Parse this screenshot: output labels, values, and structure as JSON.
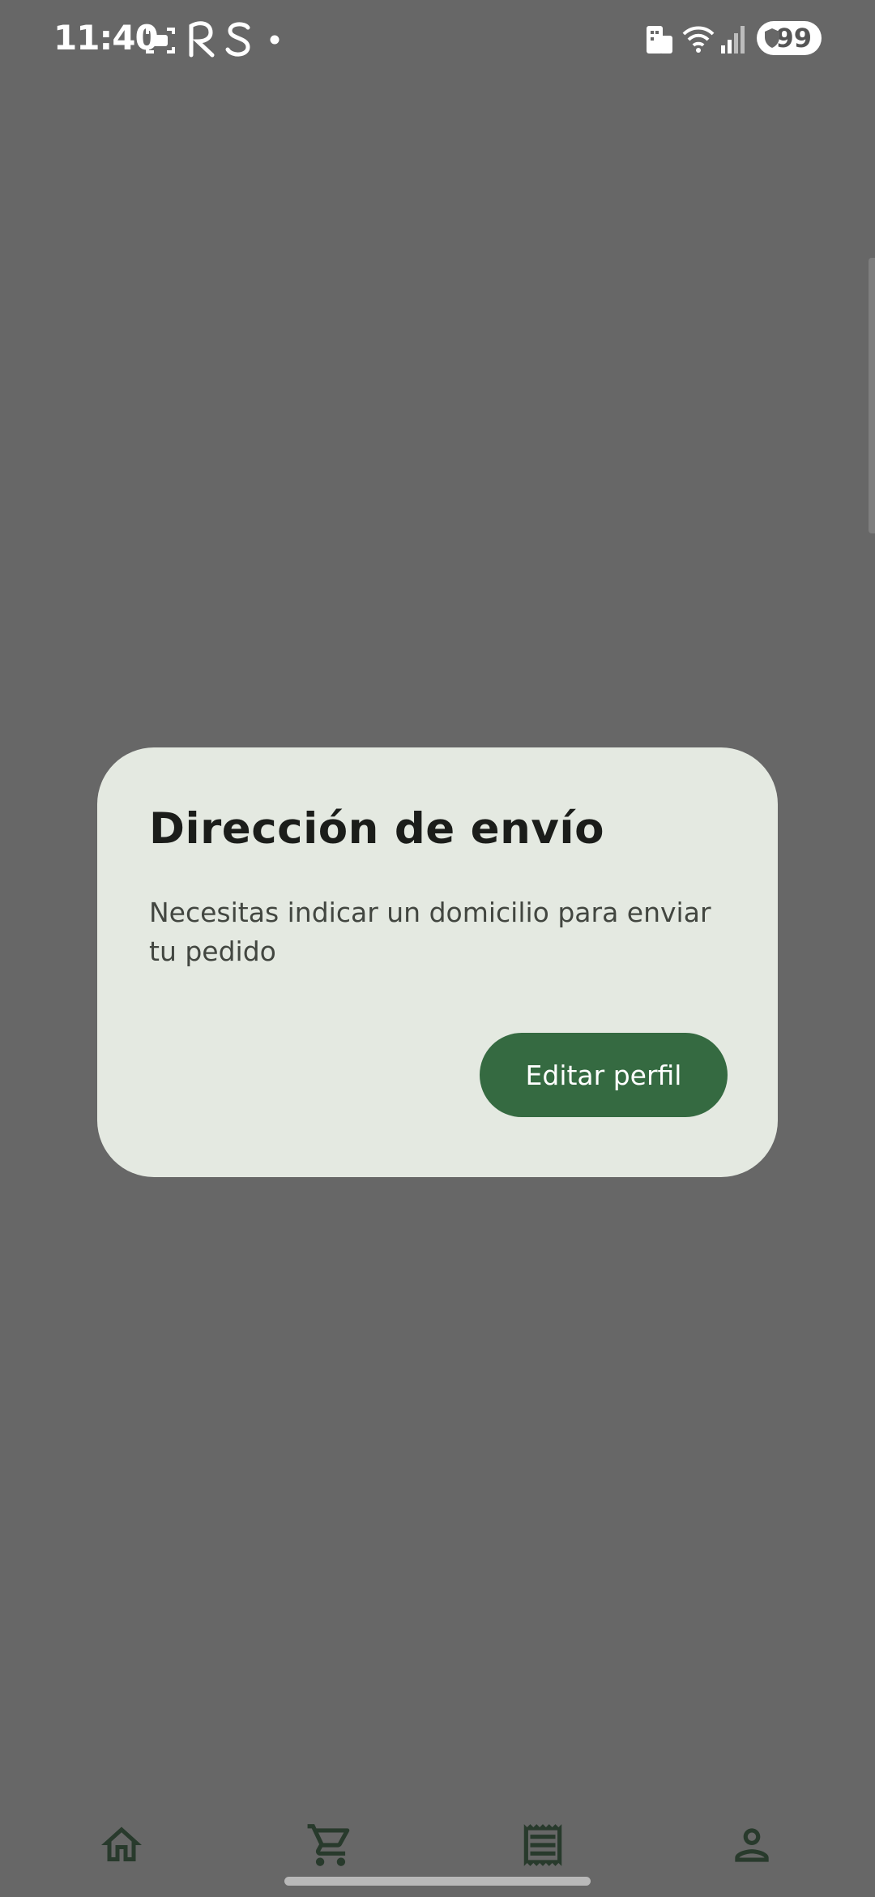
{
  "status_bar": {
    "time": "11:40",
    "battery": "99",
    "icons": [
      "screenshot-icon",
      "r-app-icon",
      "s-app-icon",
      "notification-dot-icon",
      "hotel-icon",
      "wifi-icon",
      "signal-icon",
      "shield-icon"
    ]
  },
  "dialog": {
    "title": "Dirección de envío",
    "message": "Necesitas indicar un domicilio para enviar tu pedido",
    "button_label": "Editar perfil"
  },
  "bottom_nav": {
    "items": [
      "home-icon",
      "cart-icon",
      "receipt-icon",
      "profile-icon"
    ]
  },
  "colors": {
    "scrim": "#676767",
    "dialog_surface": "#e4e9e1",
    "primary": "#356a41",
    "nav_icon": "#283a2c"
  }
}
